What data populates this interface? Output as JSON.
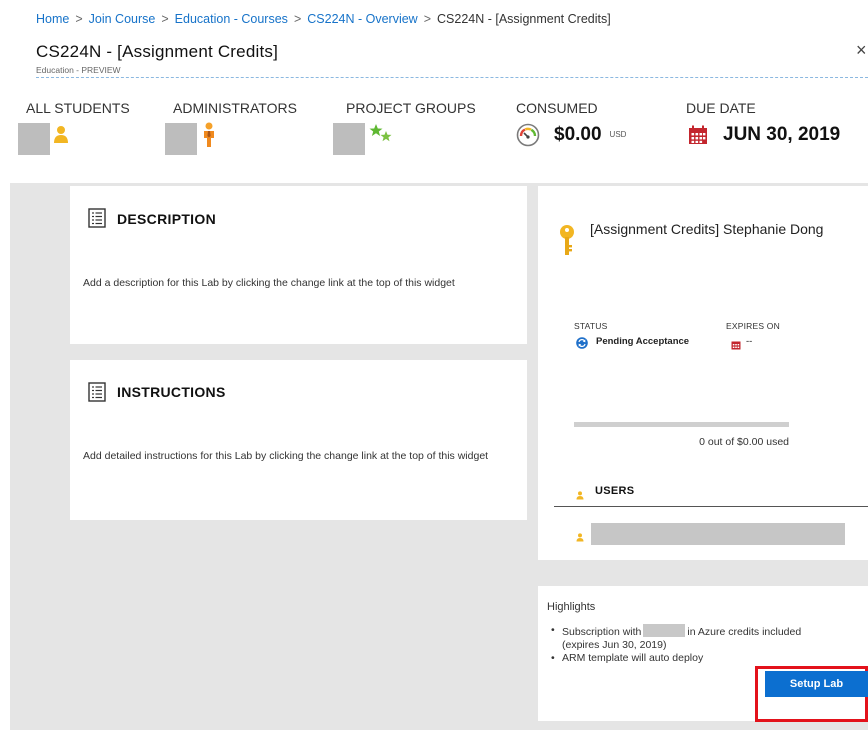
{
  "breadcrumb": [
    {
      "label": "Home"
    },
    {
      "label": "Join Course"
    },
    {
      "label": "Education - Courses"
    },
    {
      "label": "CS224N - Overview"
    },
    {
      "label": "CS224N - [Assignment Credits]"
    }
  ],
  "breadcrumb_separator": ">",
  "header": {
    "title": "CS224N - [Assignment Credits]",
    "subtitle": "Education - PREVIEW",
    "close_glyph": "×"
  },
  "stats": {
    "all_students": {
      "label": "ALL STUDENTS",
      "icon": "user-icon"
    },
    "administrators": {
      "label": "ADMINISTRATORS",
      "icon": "admin-icon"
    },
    "project_groups": {
      "label": "PROJECT GROUPS",
      "icon": "stars-icon"
    },
    "consumed": {
      "label": "CONSUMED",
      "value": "$0.00",
      "unit": "USD",
      "icon": "gauge-icon"
    },
    "due_date": {
      "label": "DUE DATE",
      "value": "JUN 30, 2019",
      "icon": "calendar-icon"
    }
  },
  "description": {
    "heading": "DESCRIPTION",
    "text": "Add a description for this Lab by clicking the change link at the top of this widget"
  },
  "instructions": {
    "heading": "INSTRUCTIONS",
    "text": "Add detailed instructions for this Lab by clicking the change link at the top of this widget"
  },
  "lab": {
    "title": "[Assignment Credits] Stephanie Dong",
    "status_label": "STATUS",
    "status_value": "Pending Acceptance",
    "expires_label": "EXPIRES ON",
    "expires_value": "--",
    "usage_text": "0 out of $0.00 used",
    "usage_fraction": 0,
    "users_heading": "USERS"
  },
  "highlights": {
    "heading": "Highlights",
    "item1_before": "Subscription with",
    "item1_after": "in Azure credits included",
    "item1_line2": "(expires Jun 30, 2019)",
    "item2": "ARM template will auto deploy"
  },
  "setup_button": {
    "label": "Setup Lab"
  },
  "colors": {
    "link": "#1773c9",
    "accent_button": "#0c6fd0",
    "highlight_red": "#e3121b",
    "calendar_red": "#c3262e",
    "icon_yellow": "#f2b623",
    "status_blue": "#1e6fc9"
  }
}
